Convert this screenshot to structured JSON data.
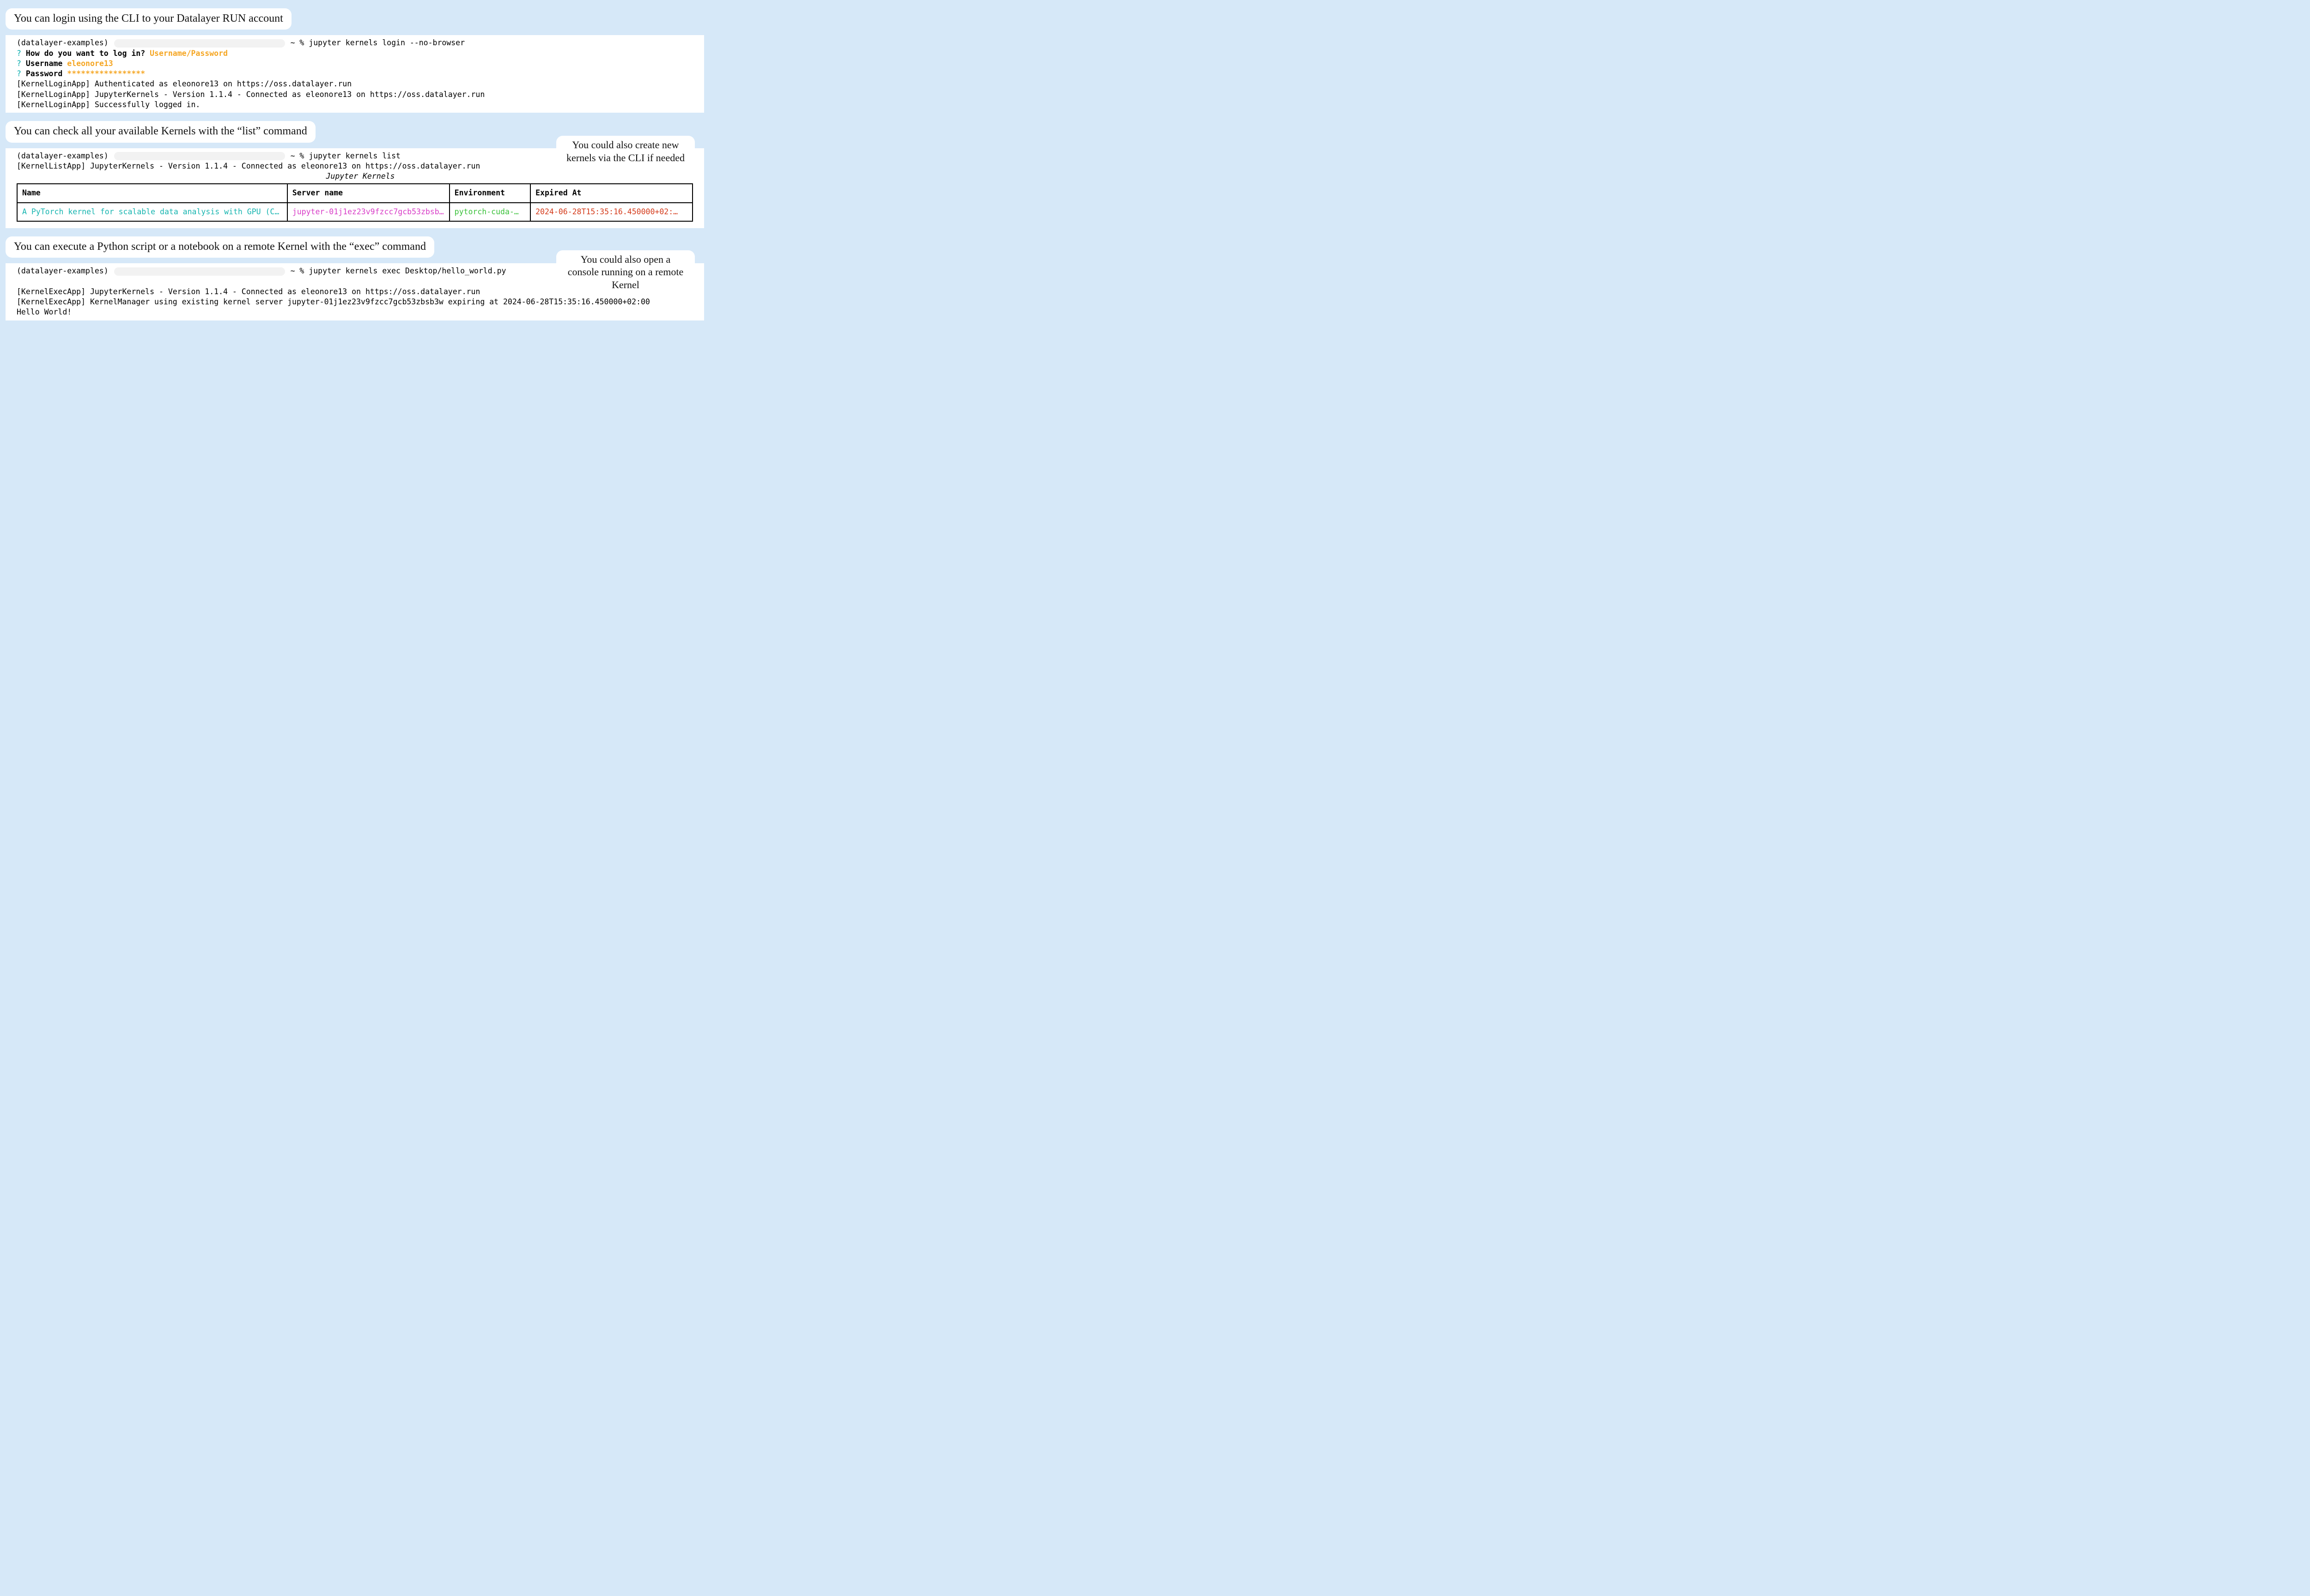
{
  "labels": {
    "login": "You can login using the CLI to your Datalayer RUN account",
    "list": "You can check all your available Kernels with the “list” command",
    "exec": "You can execute a Python script or a notebook on a remote Kernel with the “exec” command",
    "side_list": "You could also create new kernels via the CLI if needed",
    "side_exec": "You could also open a console running on a remote Kernel"
  },
  "login": {
    "env": "(datalayer-examples)",
    "prompt_tail": "~ % jupyter kernels login --no-browser",
    "q1_prefix": "?",
    "q1": "How do you want to log in?",
    "q1_ans": "Username/Password",
    "q2": "Username",
    "q2_ans": "eleonore13",
    "q3": "Password",
    "q3_ans": "*****************",
    "out1": "[KernelLoginApp] Authenticated as eleonore13 on https://oss.datalayer.run",
    "out2": "[KernelLoginApp] JupyterKernels - Version 1.1.4 - Connected as eleonore13 on https://oss.datalayer.run",
    "out3": "[KernelLoginApp] Successfully logged in."
  },
  "list": {
    "env": "(datalayer-examples)",
    "prompt_tail": "~ % jupyter kernels list",
    "out1": "[KernelListApp] JupyterKernels - Version 1.1.4 - Connected as eleonore13 on https://oss.datalayer.run",
    "title": "Jupyter Kernels",
    "headers": {
      "name": "Name",
      "server": "Server name",
      "env": "Environment",
      "exp": "Expired At"
    },
    "row": {
      "name": "A PyTorch kernel for scalable data analysis with GPU (CUD…",
      "server": "jupyter-01j1ez23v9fzcc7gcb53zbsb…",
      "env": "pytorch-cuda-…",
      "exp": "2024-06-28T15:35:16.450000+02:…"
    }
  },
  "exec": {
    "env": "(datalayer-examples)",
    "prompt_tail": "~ % jupyter kernels exec Desktop/hello_world.py",
    "out1": "[KernelExecApp] JupyterKernels - Version 1.1.4 - Connected as eleonore13 on https://oss.datalayer.run",
    "out2": "[KernelExecApp] KernelManager using existing kernel server jupyter-01j1ez23v9fzcc7gcb53zbsb3w expiring at 2024-06-28T15:35:16.450000+02:00",
    "out3": "Hello World!"
  }
}
